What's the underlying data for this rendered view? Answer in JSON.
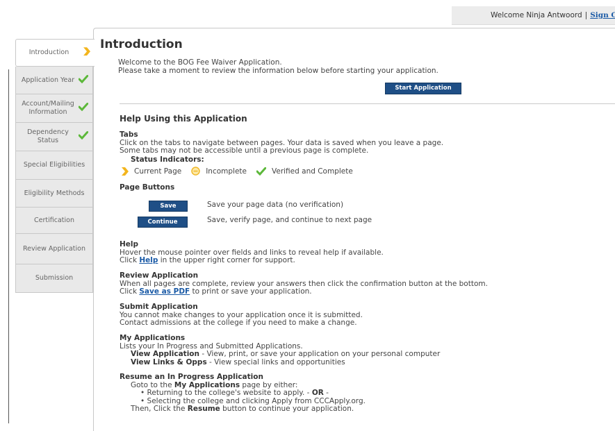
{
  "header": {
    "welcome": "Welcome Ninja Antwoord",
    "separator": "|",
    "signout": "Sign O"
  },
  "sidebar": {
    "items": [
      {
        "label": "Introduction",
        "status": "current"
      },
      {
        "label": "Application Year",
        "status": "complete"
      },
      {
        "label": "Account/Mailing Information",
        "status": "complete"
      },
      {
        "label": "Dependency Status",
        "status": "complete"
      },
      {
        "label": "Special Eligibilities",
        "status": "none"
      },
      {
        "label": "Eligibility Methods",
        "status": "none"
      },
      {
        "label": "Certification",
        "status": "none"
      },
      {
        "label": "Review Application",
        "status": "none"
      },
      {
        "label": "Submission",
        "status": "none"
      }
    ]
  },
  "main": {
    "title": "Introduction",
    "intro_line1": "Welcome to the BOG Fee Waiver Application.",
    "intro_line2": "Please take a moment to review the information below before starting your application.",
    "start_button": "Start Application",
    "help_title": "Help Using this Application",
    "tabs": {
      "heading": "Tabs",
      "line1": "Click on the tabs to navigate between pages. Your data is saved when you leave a page.",
      "line2": "Some tabs may not be accessible until a previous page is complete.",
      "status_heading": "Status Indicators:",
      "current": "Current Page",
      "incomplete": "Incomplete",
      "verified": "Verified and Complete"
    },
    "page_buttons": {
      "heading": "Page Buttons",
      "save_label": "Save",
      "save_desc": "Save your page data (no verification)",
      "continue_label": "Continue",
      "continue_desc": "Save, verify page, and continue to next page"
    },
    "help": {
      "heading": "Help",
      "line1": "Hover the mouse pointer over fields and links to reveal help if available.",
      "line2_pre": "Click ",
      "line2_link": "Help",
      "line2_post": " in the upper right corner for support."
    },
    "review": {
      "heading": "Review Application",
      "line1": "When all pages are complete, review your answers then click the confirmation button at the bottom.",
      "line2_pre": "Click ",
      "line2_link": "Save as PDF",
      "line2_post": " to print or save your application."
    },
    "submit": {
      "heading": "Submit Application",
      "line1": "You cannot make changes to your application once it is submitted.",
      "line2": "Contact admissions at the college if you need to make a change."
    },
    "myapps": {
      "heading": "My Applications",
      "line1": "Lists your In Progress and Submitted Applications.",
      "view_app_bold": "View Application",
      "view_app_rest": " - View, print, or save your application on your personal computer",
      "view_links_bold": "View Links & Opps",
      "view_links_rest": " - View special links and opportunities"
    },
    "resume": {
      "heading": "Resume an In Progress Application",
      "goto_pre": "Goto to the ",
      "goto_bold": "My Applications",
      "goto_post": " page by either:",
      "bullet1_pre": "• Returning to the college's website to apply. - ",
      "bullet1_bold": "OR",
      "bullet1_post": " -",
      "bullet2": "• Selecting the college and clicking Apply from CCCApply.org.",
      "then_pre": "Then, Click the ",
      "then_bold": "Resume",
      "then_post": " button to continue your application."
    }
  }
}
